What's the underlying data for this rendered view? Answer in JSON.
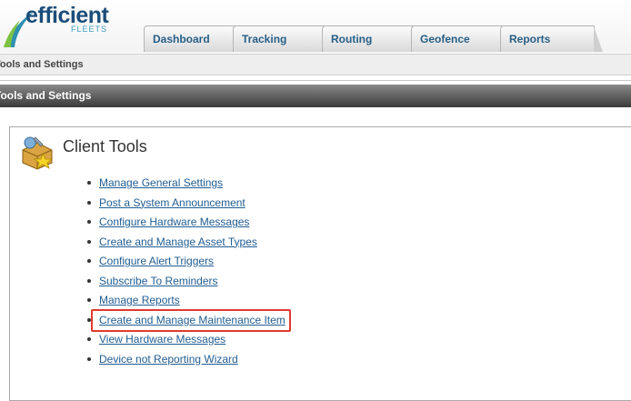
{
  "logo": {
    "word": "efficient",
    "sub": "FLEETS"
  },
  "tabs": [
    {
      "label": "Dashboard"
    },
    {
      "label": "Tracking"
    },
    {
      "label": "Routing"
    },
    {
      "label": "Geofence"
    },
    {
      "label": "Reports"
    }
  ],
  "breadcrumb": "Tools and Settings",
  "section": {
    "title": "Tools and Settings"
  },
  "panel": {
    "title": "Client Tools",
    "items": [
      "Manage General Settings",
      "Post a System Announcement",
      "Configure Hardware Messages",
      "Create and Manage Asset Types",
      "Configure Alert Triggers",
      "Subscribe To Reminders",
      "Manage Reports",
      "Create and Manage Maintenance Item",
      "View Hardware Messages",
      "Device not Reporting Wizard"
    ]
  },
  "colors": {
    "link": "#215d92",
    "highlight": "#e03a2e",
    "tab_text": "#275f86"
  }
}
